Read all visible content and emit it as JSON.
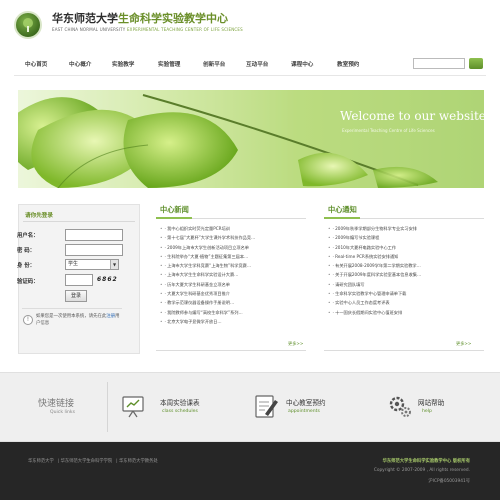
{
  "header": {
    "university": "华东师范大学",
    "center": "生命科学实验教学中心",
    "english_university": "EAST CHINA NORMAL UNIVERSITY",
    "english_center": "EXPERIMENTAL TEACHING CENTER OF LIFE SCIENCES"
  },
  "nav": {
    "items": [
      "中心首页",
      "中心概介",
      "实验教学",
      "实验管理",
      "创新平台",
      "互动平台",
      "课程中心",
      "教室预约"
    ]
  },
  "banner": {
    "welcome": "Welcome to our website",
    "subtitle": "Experimental Teaching Centre of Life Sciences"
  },
  "login": {
    "title": "请你先登录",
    "username_label": "用户名：",
    "password_label": "密 码：",
    "identity_label": "身 份：",
    "identity_value": "学生",
    "captcha_label": "验证码：",
    "captcha_value": "6862",
    "button": "登录",
    "note_prefix": "如果您是一次使用本系统，请先在此",
    "note_link": "注册",
    "note_suffix": "用户信息"
  },
  "news": {
    "title": "中心新闻",
    "more": "更多>>",
    "items": [
      "· 我中心组织实时荧光定量PCR培训",
      "· 第十七届“大夏杯”大学生课外学术科技作品竞…",
      "· 2009年上海市大学生创新活动项目立项名单",
      "· 生科院举办“大夏·植物”主题征集第三届本…",
      "· 上海市大学生学科竞赛“上海生物”科学竞赛…",
      "· 上海市大学生生命科学实验设计大赛…",
      "· 历年大夏大学生科研基金立项名单",
      "· 大夏大学生科研基金优秀项目推介",
      "· 教学示范课仪器设备操作手册说明…",
      "· 我院教师参与编写“高校生命科学”系列…",
      "· 北京大学电子显微学开放日…"
    ]
  },
  "notices": {
    "title": "中心通知",
    "more": "更多>>",
    "items": [
      "· 2009年秋季学期部分生物科学专业实习安排",
      "· 2009年编写节实验课程",
      "· 2010年大夏杯电路实验中心工作",
      "· Real-time PCR系统实验安排通知",
      "· 有关开展2008-2009学年第二学期实验教学…",
      "· 关于开展2009年度科学实验室基本信息收集…",
      "· 请研究团队填写",
      "· 生命科学实验教学中心管理申请单下载",
      "· 实验中心人员工作态度考评表",
      "· 十一国庆长假期间实验中心值班安排"
    ]
  },
  "quick_links": {
    "title": "快速链接",
    "subtitle": "Quick links",
    "items": [
      {
        "label": "本周实验课表",
        "sub": "class schedules",
        "icon": "projector-icon"
      },
      {
        "label": "中心教室预约",
        "sub": "appointments",
        "icon": "clipboard-pen-icon"
      },
      {
        "label": "网站帮助",
        "sub": "help",
        "icon": "gears-icon"
      }
    ]
  },
  "footer": {
    "links": [
      "华东师范大学",
      "华东师范大学生命科学学院",
      "华东师范大学教务处"
    ],
    "center_name": "华东师范大学生命科学实验教学中心 版权所有",
    "copyright": "Copyright © 2007-2009 , All rights reserved.",
    "icp": "沪ICP备05003941号"
  },
  "colors": {
    "accent": "#6b8f2a",
    "footer_bg": "#262626"
  }
}
